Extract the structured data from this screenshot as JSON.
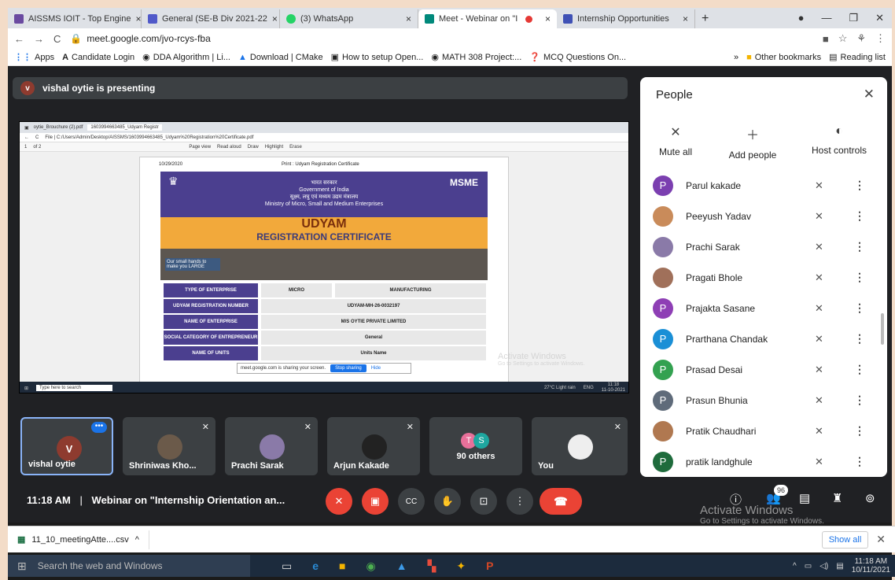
{
  "browser": {
    "tabs": [
      {
        "label": "AISSMS IOIT - Top Engine",
        "color": "#6a4aa0"
      },
      {
        "label": "General (SE-B Div 2021-22",
        "color": "#5059c9"
      },
      {
        "label": "(3) WhatsApp",
        "color": "#25d366"
      },
      {
        "label": "Meet - Webinar on \"I",
        "color": "#00897b",
        "active": true
      },
      {
        "label": "Internship Opportunities",
        "color": "#3f51b5"
      }
    ],
    "new_tab": "+",
    "url": "meet.google.com/jvo-rcys-fba",
    "bookmarks": [
      "Apps",
      "Candidate Login",
      "DDA Algorithm | Li...",
      "Download | CMake",
      "How to setup Open...",
      "MATH 308 Project:...",
      "MCQ Questions On..."
    ],
    "bookmarks_more": "»",
    "other_bookmarks": "Other bookmarks",
    "reading_list": "Reading list"
  },
  "meet": {
    "presenter_avatar": "v",
    "presenting_text": "vishal oytie is presenting",
    "shared_screen": {
      "tabs": [
        "oytie_Brouchure (2).pdf",
        "1603994663485_Udyam Registr"
      ],
      "url": "File | C:/Users/Admin/Desktop/AISSMS/1603994663485_Udyam%20Registration%20Certificate.pdf",
      "page": "of 2",
      "page_num": "1",
      "toolbar": [
        "Page view",
        "Read aloud",
        "Draw",
        "Highlight",
        "Erase"
      ],
      "doc_date": "10/29/2020",
      "doc_header": "Print : Udyam Registration Certificate",
      "gov_hi": "भारत सरकार",
      "gov_en": "Government of India",
      "ministry_hi": "सूक्ष्म, लघु एवं मध्यम उद्यम मंत्रालय",
      "ministry_en": "Ministry of Micro, Small and Medium Enterprises",
      "msme_logo": "MSME",
      "cert_title1": "UDYAM",
      "cert_title2": "REGISTRATION CERTIFICATE",
      "photo_text": "Our small hands to make you LARGE",
      "rows": [
        {
          "k": "TYPE OF ENTERPRISE",
          "v": "MICRO",
          "v2": "MANUFACTURING"
        },
        {
          "k": "UDYAM REGISTRATION NUMBER",
          "v": "UDYAM-MH-26-0032197"
        },
        {
          "k": "NAME OF ENTERPRISE",
          "v": "M/S OYTIE PRIVATE LIMITED"
        },
        {
          "k": "SOCIAL CATEGORY OF ENTREPRENEUR",
          "v": "General"
        },
        {
          "k": "NAME OF UNITS",
          "v": "Units Name"
        }
      ],
      "sharing_text": "meet.google.com is sharing your screen.",
      "stop_sharing": "Stop sharing",
      "hide": "Hide",
      "taskbar_search": "Type here to search",
      "weather": "27°C Light rain",
      "lang": "ENG",
      "time": "11:18",
      "date": "11-10-2021",
      "activate1": "Activate Windows",
      "activate2": "Go to Settings to activate Windows."
    },
    "tiles": [
      {
        "name": "vishal oytie",
        "initial": "V"
      },
      {
        "name": "Shriniwas Kho..."
      },
      {
        "name": "Prachi Sarak"
      },
      {
        "name": "Arjun Kakade"
      },
      {
        "name": "90 others",
        "i1": "T",
        "i2": "S"
      },
      {
        "name": "You"
      }
    ],
    "clock": "11:18 AM",
    "separator": "|",
    "meeting_title": "Webinar on \"Internship Orientation an...",
    "people_count": "96",
    "activate1": "Activate Windows",
    "activate2": "Go to Settings to activate Windows."
  },
  "people": {
    "title": "People",
    "actions": [
      "Mute all",
      "Add people",
      "Host controls"
    ],
    "list": [
      {
        "name": "Parul kakade",
        "initial": "P",
        "color": "#7b3fb0"
      },
      {
        "name": "Peeyush Yadav",
        "initial": "",
        "color": "#c98b5a"
      },
      {
        "name": "Prachi Sarak",
        "initial": "",
        "color": "#8a7aa8"
      },
      {
        "name": "Pragati Bhole",
        "initial": "",
        "color": "#a0705a"
      },
      {
        "name": "Prajakta Sasane",
        "initial": "P",
        "color": "#8e3fb5"
      },
      {
        "name": "Prarthana Chandak",
        "initial": "P",
        "color": "#1a8fd6"
      },
      {
        "name": "Prasad Desai",
        "initial": "P",
        "color": "#33a150"
      },
      {
        "name": "Prasun Bhunia",
        "initial": "P",
        "color": "#5f6b7a"
      },
      {
        "name": "Pratik Chaudhari",
        "initial": "",
        "color": "#b07850"
      },
      {
        "name": "pratik landghule",
        "initial": "P",
        "color": "#1e6b3c"
      }
    ]
  },
  "downloads": {
    "file": "11_10_meetingAtte....csv",
    "show_all": "Show all"
  },
  "taskbar": {
    "search": "Search the web and Windows",
    "time": "11:18 AM",
    "date": "10/11/2021"
  }
}
